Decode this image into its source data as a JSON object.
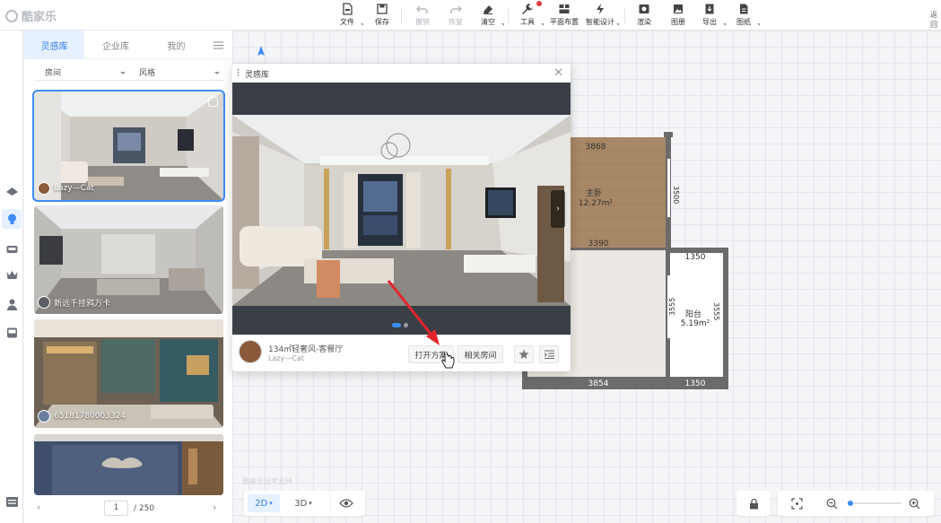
{
  "app": {
    "logo_text": "酷家乐",
    "corner_text": "返回"
  },
  "toolbar": [
    {
      "label": "文件",
      "icon": "file-icon",
      "disabled": false
    },
    {
      "label": "保存",
      "icon": "save-icon",
      "disabled": false
    },
    {
      "label": "撤销",
      "icon": "undo-icon",
      "disabled": true
    },
    {
      "label": "恢复",
      "icon": "redo-icon",
      "disabled": true
    },
    {
      "label": "清空",
      "icon": "eraser-icon",
      "disabled": false
    },
    {
      "label": "工具",
      "icon": "wrench-icon",
      "disabled": false
    },
    {
      "label": "平面布置",
      "icon": "layout-icon",
      "disabled": false
    },
    {
      "label": "智能设计",
      "icon": "lightning-icon",
      "disabled": false
    },
    {
      "label": "渲染",
      "icon": "render-icon",
      "disabled": false
    },
    {
      "label": "图册",
      "icon": "album-icon",
      "disabled": false
    },
    {
      "label": "导出",
      "icon": "export-icon",
      "disabled": false
    },
    {
      "label": "图纸",
      "icon": "drawing-icon",
      "disabled": false
    }
  ],
  "library": {
    "tabs": [
      "灵感库",
      "企业库",
      "我的"
    ],
    "active_tab": 0,
    "filters": [
      "房间",
      "风格"
    ],
    "thumbnails": [
      {
        "author": "Lazy—Cat",
        "selected": true
      },
      {
        "author": "新远千挂鸦万卡",
        "selected": false
      },
      {
        "author": "65181780003324",
        "selected": false
      },
      {
        "author": "",
        "selected": false
      }
    ],
    "pager": {
      "current": "1",
      "total": "/ 250"
    }
  },
  "inspiration_panel": {
    "title": "灵感库",
    "design_name": "134㎡轻奢风-客餐厅",
    "author": "Lazy—Cat",
    "open_button": "打开方案",
    "related_button": "相关房间"
  },
  "floorplan": {
    "rooms": [
      {
        "name": "主卧",
        "area": "12.27m²"
      },
      {
        "name": "阳台",
        "area": "5.19m²"
      }
    ],
    "dimensions": [
      "3868",
      "3390",
      "1350",
      "3555",
      "3555",
      "3854",
      "1350",
      "3500"
    ]
  },
  "bottom": {
    "view_2d": "2D",
    "view_3d": "3D",
    "zoom_level": 0.05
  },
  "watermark": "酷家乐技术支持",
  "colors": {
    "accent": "#2e7ff5",
    "arrow": "#e4252b"
  }
}
